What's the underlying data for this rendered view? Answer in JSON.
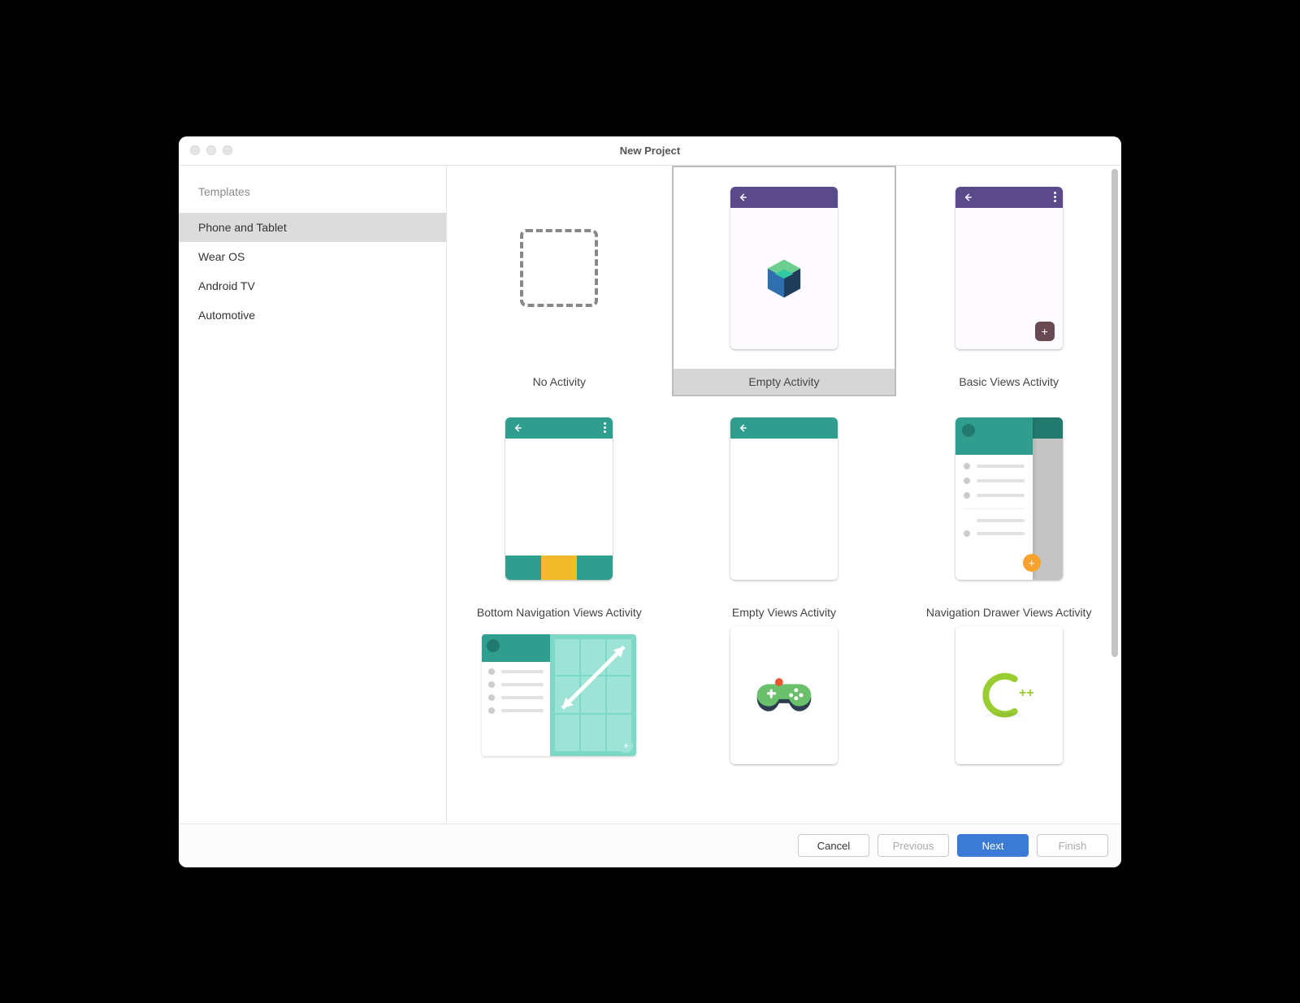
{
  "window": {
    "title": "New Project"
  },
  "sidebar": {
    "heading": "Templates",
    "items": [
      {
        "label": "Phone and Tablet",
        "selected": true
      },
      {
        "label": "Wear OS",
        "selected": false
      },
      {
        "label": "Android TV",
        "selected": false
      },
      {
        "label": "Automotive",
        "selected": false
      }
    ]
  },
  "templates": [
    {
      "label": "No Activity",
      "icon": "dashed-square",
      "selected": false
    },
    {
      "label": "Empty Activity",
      "icon": "compose-cube",
      "appbar": "purple",
      "selected": true
    },
    {
      "label": "Basic Views Activity",
      "icon": "fab-plus",
      "appbar": "purple",
      "selected": false
    },
    {
      "label": "Bottom Navigation Views Activity",
      "icon": "bottom-nav",
      "appbar": "teal",
      "selected": false
    },
    {
      "label": "Empty Views Activity",
      "icon": "blank",
      "appbar": "teal",
      "selected": false
    },
    {
      "label": "Navigation Drawer Views Activity",
      "icon": "nav-drawer",
      "appbar": "teal",
      "selected": false
    },
    {
      "label": "",
      "icon": "responsive",
      "appbar": "teal",
      "selected": false
    },
    {
      "label": "",
      "icon": "game-controller",
      "selected": false
    },
    {
      "label": "",
      "icon": "cpp",
      "selected": false
    }
  ],
  "footer": {
    "cancel": "Cancel",
    "previous": "Previous",
    "next": "Next",
    "finish": "Finish"
  }
}
